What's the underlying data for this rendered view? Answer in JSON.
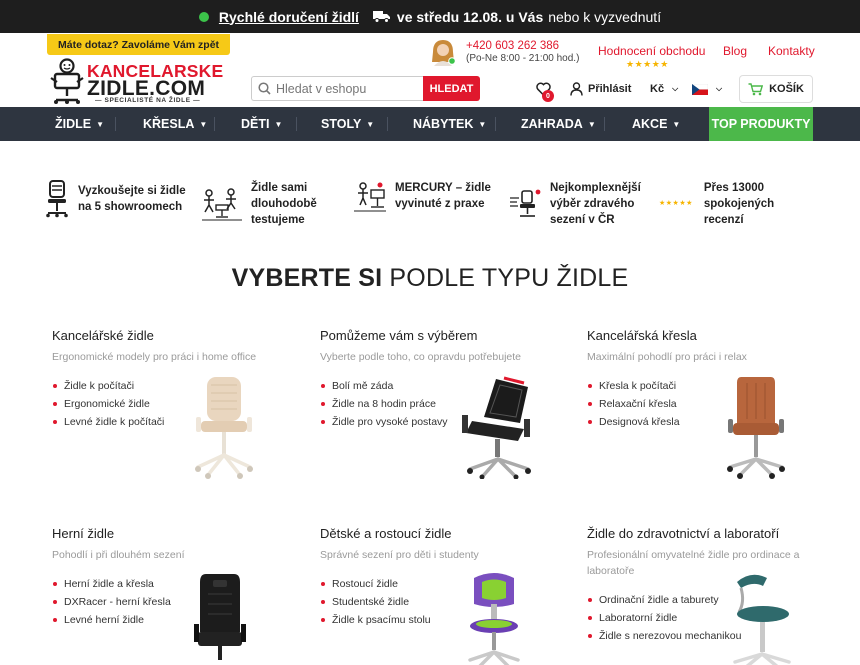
{
  "topbar": {
    "fast_link": "Rychlé doručení židlí",
    "when": "ve středu 12.08. u Vás",
    "rest": "nebo k vyzvednutí"
  },
  "header": {
    "call_badge": "Máte dotaz? Zavoláme Vám zpět",
    "logo_line1": "KANCELARSKE",
    "logo_line2": "ZIDLE.COM",
    "logo_tagline": "— SPECIALISTÉ NA ŽIDLE —",
    "phone": "+420 603 262 386",
    "hours": "(Po-Ne 8:00 - 21:00 hod.)",
    "rating_link": "Hodnocení obchodu",
    "rating_stars": "★★★★★",
    "blog": "Blog",
    "contacts": "Kontakty",
    "search_placeholder": "Hledat v eshopu",
    "search_button": "HLEDAT",
    "wishlist_count": "0",
    "login": "Přihlásit",
    "currency": "Kč",
    "cart": "KOŠÍK"
  },
  "nav": {
    "items": [
      "ŽIDLE",
      "KŘESLA",
      "DĚTI",
      "STOLY",
      "NÁBYTEK",
      "ZAHRADA",
      "AKCE"
    ],
    "top_products": "TOP PRODUKTY"
  },
  "usps": [
    {
      "line1": "Vyzkoušejte si židle",
      "line2": "na 5 showroomech",
      "line3": ""
    },
    {
      "line1": "Židle sami",
      "line2": "dlouhodobě",
      "line3": "testujeme"
    },
    {
      "line1": "MERCURY – židle",
      "line2": "vyvinuté z praxe",
      "line3": ""
    },
    {
      "line1": "Nejkomplexnější",
      "line2": "výběr zdravého",
      "line3": "sezení v ČR"
    },
    {
      "line1": "Přes 13000",
      "line2": "spokojených",
      "line3": "recenzí",
      "stars": "★★★★★"
    }
  ],
  "heading": {
    "bold": "VYBERTE SI",
    "rest": " PODLE TYPU ŽIDLE"
  },
  "categories": [
    {
      "title": "Kancelářské židle",
      "subtitle": "Ergonomické modely pro práci i home office",
      "links": [
        "Židle k počítači",
        "Ergonomické židle",
        "Levné židle k počítači"
      ]
    },
    {
      "title": "Pomůžeme vám s výběrem",
      "subtitle": "Vyberte podle toho, co opravdu potřebujete",
      "links": [
        "Bolí mě záda",
        "Židle na 8 hodin práce",
        "Židle pro vysoké postavy"
      ]
    },
    {
      "title": "Kancelářská křesla",
      "subtitle": "Maximální pohodlí pro práci i relax",
      "links": [
        "Křesla k počítači",
        "Relaxační křesla",
        "Designová křesla"
      ]
    },
    {
      "title": "Herní židle",
      "subtitle": "Pohodlí i při dlouhém sezení",
      "links": [
        "Herní židle a křesla",
        "DXRacer - herní křesla",
        "Levné herní židle"
      ]
    },
    {
      "title": "Dětské a rostoucí židle",
      "subtitle": "Správné sezení pro děti i studenty",
      "links": [
        "Rostoucí židle",
        "Studentské židle",
        "Židle k psacímu stolu"
      ]
    },
    {
      "title": "Židle do zdravotnictví a laboratoří",
      "subtitle": "Profesionální omyvatelné židle pro ordinace a laboratoře",
      "links": [
        "Ordinační židle a taburety",
        "Laboratorní židle",
        "Židle s nerezovou mechanikou"
      ]
    }
  ],
  "colors": {
    "brand_red": "#e0182d",
    "nav_bg": "#2e3540",
    "top_green": "#4cb84a",
    "badge_yellow": "#f6c917"
  }
}
